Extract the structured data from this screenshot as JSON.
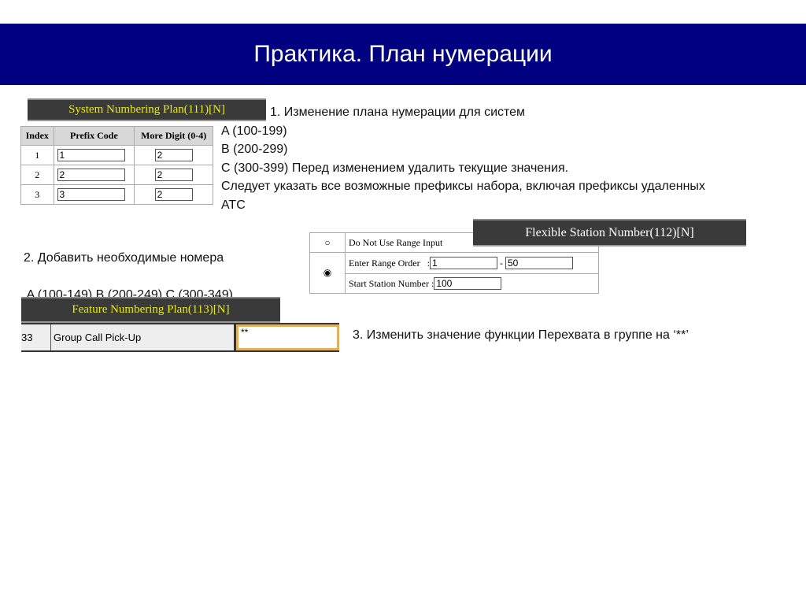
{
  "title": "Практика. План нумерации",
  "system_plan": {
    "header": "System Numbering Plan(111)[N]",
    "columns": [
      "Index",
      "Prefix Code",
      "More Digit (0-4)"
    ],
    "rows": [
      {
        "index": "1",
        "prefix": "1",
        "more": "2"
      },
      {
        "index": "2",
        "prefix": "2",
        "more": "2"
      },
      {
        "index": "3",
        "prefix": "3",
        "more": "2"
      }
    ]
  },
  "step1": [
    "1. Изменение плана нумерации для систем",
    "A (100-199)",
    "B (200-299)",
    "C (300-399) Перед изменением удалить текущие значения.",
    "Следует указать все возможные префиксы набора, включая префиксы удаленных",
    "АТС"
  ],
  "step2": [
    "2. Добавить необходимые номера",
    " A (100-149) B (200-249) C (300-349)"
  ],
  "flexible": {
    "header": "Flexible Station Number(112)[N]",
    "option1": "Do Not Use Range Input",
    "range_label": "Enter Range Order   :",
    "range_from": "1",
    "range_sep": "-",
    "range_to": "50",
    "start_label": "Start Station Number :",
    "start_value": "100",
    "selected": "range"
  },
  "feature_plan": {
    "header": "Feature Numbering Plan(113)[N]",
    "index": "33",
    "name": "Group Call Pick-Up",
    "value": "**"
  },
  "step3": "3. Изменить значение функции Перехвата в группе на ‘**’"
}
